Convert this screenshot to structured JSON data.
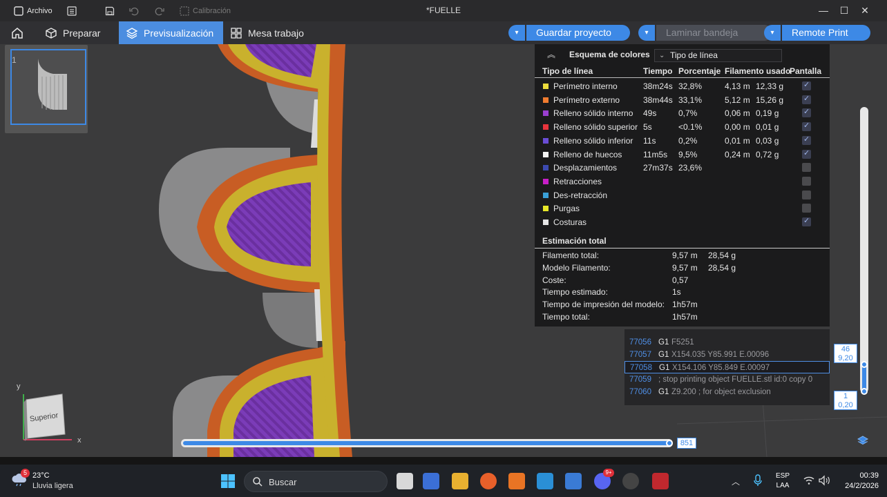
{
  "titlebar": {
    "file_menu": "Archivo",
    "calibration": "Calibración",
    "title": "*FUELLE"
  },
  "toolbar": {
    "prepare": "Preparar",
    "preview": "Previsualización",
    "workspace": "Mesa trabajo",
    "save_project": "Guardar proyecto",
    "slice_plate": "Laminar bandeja",
    "remote_print": "Remote Print"
  },
  "plate": {
    "number": "1"
  },
  "legend": {
    "title": "Esquema de colores",
    "select_value": "Tipo de línea",
    "columns": {
      "type": "Tipo de línea",
      "time": "Tiempo",
      "percent": "Porcentaje",
      "filament": "Filamento usado",
      "display": "Pantalla"
    },
    "rows": [
      {
        "name": "Perímetro interno",
        "time": "38m24s",
        "percent": "32,8%",
        "length": "4,13 m",
        "weight": "12,33 g",
        "color": "#ecdc3c",
        "shown": true
      },
      {
        "name": "Perímetro externo",
        "time": "38m44s",
        "percent": "33,1%",
        "length": "5,12 m",
        "weight": "15,26 g",
        "color": "#f07c30",
        "shown": true
      },
      {
        "name": "Relleno sólido interno",
        "time": "49s",
        "percent": "0,7%",
        "length": "0,06 m",
        "weight": "0,19 g",
        "color": "#9b3fd1",
        "shown": true
      },
      {
        "name": "Relleno sólido superior",
        "time": "5s",
        "percent": "<0.1%",
        "length": "0,00 m",
        "weight": "0,01 g",
        "color": "#e8343c",
        "shown": true
      },
      {
        "name": "Relleno sólido inferior",
        "time": "11s",
        "percent": "0,2%",
        "length": "0,01 m",
        "weight": "0,03 g",
        "color": "#6a4dd6",
        "shown": true
      },
      {
        "name": "Relleno de huecos",
        "time": "11m5s",
        "percent": "9,5%",
        "length": "0,24 m",
        "weight": "0,72 g",
        "color": "#f4f4f4",
        "shown": true
      },
      {
        "name": "Desplazamientos",
        "time": "27m37s",
        "percent": "23,6%",
        "length": "",
        "weight": "",
        "color": "#3c4ab0",
        "shown": false
      },
      {
        "name": "Retracciones",
        "time": "",
        "percent": "",
        "length": "",
        "weight": "",
        "color": "#c81ec8",
        "shown": false
      },
      {
        "name": "Des-retracción",
        "time": "",
        "percent": "",
        "length": "",
        "weight": "",
        "color": "#3aa0d8",
        "shown": false
      },
      {
        "name": "Purgas",
        "time": "",
        "percent": "",
        "length": "",
        "weight": "",
        "color": "#e8e828",
        "shown": false
      },
      {
        "name": "Costuras",
        "time": "",
        "percent": "",
        "length": "",
        "weight": "",
        "color": "#e6e6e6",
        "shown": true
      }
    ],
    "summary_title": "Estimación total",
    "summary": [
      {
        "label": "Filamento total:",
        "v1": "9,57 m",
        "v2": "28,54 g"
      },
      {
        "label": "Modelo Filamento:",
        "v1": "9,57 m",
        "v2": "28,54 g"
      },
      {
        "label": "Coste:",
        "v1": "0,57",
        "v2": ""
      },
      {
        "label": "Tiempo estimado:",
        "v1": "1s",
        "v2": ""
      },
      {
        "label": "Tiempo de impresión del modelo:",
        "v1": "1h57m",
        "v2": ""
      },
      {
        "label": "Tiempo total:",
        "v1": "1h57m",
        "v2": ""
      }
    ]
  },
  "gcode": [
    {
      "line": "77056",
      "op": "G1",
      "args": "F5251",
      "selected": false
    },
    {
      "line": "77057",
      "op": "G1",
      "args": "X154.035 Y85.991 E.00096",
      "selected": false
    },
    {
      "line": "77058",
      "op": "G1",
      "args": "X154.106 Y85.849 E.00097",
      "selected": true
    },
    {
      "line": "77059",
      "op": "",
      "args": "; stop printing object FUELLE.stl id:0 copy 0",
      "selected": false
    },
    {
      "line": "77060",
      "op": "G1",
      "args": "Z9.200 ; for object exclusion",
      "selected": false
    }
  ],
  "layers": {
    "top_layer": "46",
    "top_height": "9,20",
    "bottom_layer": "1",
    "bottom_height": "0,20",
    "move_value": "851"
  },
  "view_cube": {
    "label": "Superior",
    "y_axis": "y",
    "x_axis": "x"
  },
  "taskbar": {
    "temperature": "23°C",
    "weather": "Lluvia ligera",
    "weather_badge": "5",
    "search": "Buscar",
    "lang1": "ESP",
    "lang2": "LAA",
    "time": "00:39",
    "date": "24/2/2026",
    "discord_badge": "9+"
  },
  "colors": {
    "accent": "#3d89e6"
  }
}
